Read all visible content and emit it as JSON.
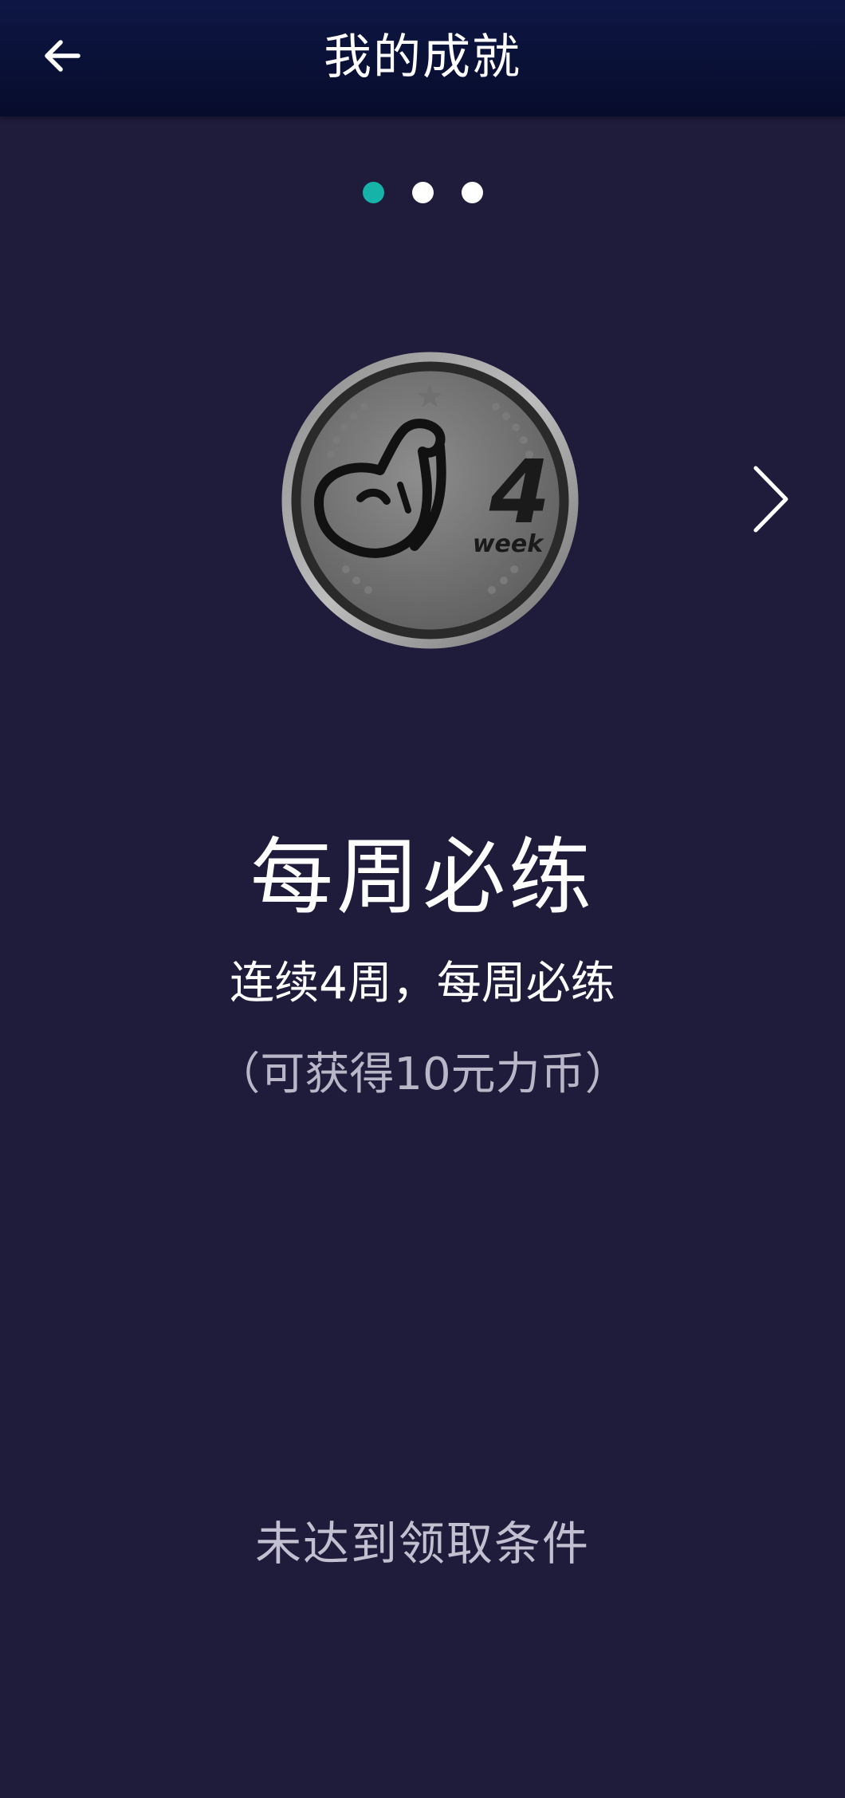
{
  "header": {
    "title": "我的成就",
    "back_icon": "arrow-left-icon"
  },
  "pager": {
    "total": 3,
    "current": 1,
    "active_color": "#15b3a8",
    "inactive_color": "#ffffff"
  },
  "achievement": {
    "medal_icon": "flexed-arm-medal-icon",
    "medal_badge_number": "4",
    "medal_badge_word": "week",
    "name": "每周必练",
    "description": "连续4周，每周必练",
    "reward": "（可获得10元力币）",
    "status": "未达到领取条件"
  },
  "navigation": {
    "next_icon": "chevron-right-icon"
  },
  "colors": {
    "background": "#1f1b3a",
    "header": "#0b1236",
    "accent": "#15b3a8"
  }
}
